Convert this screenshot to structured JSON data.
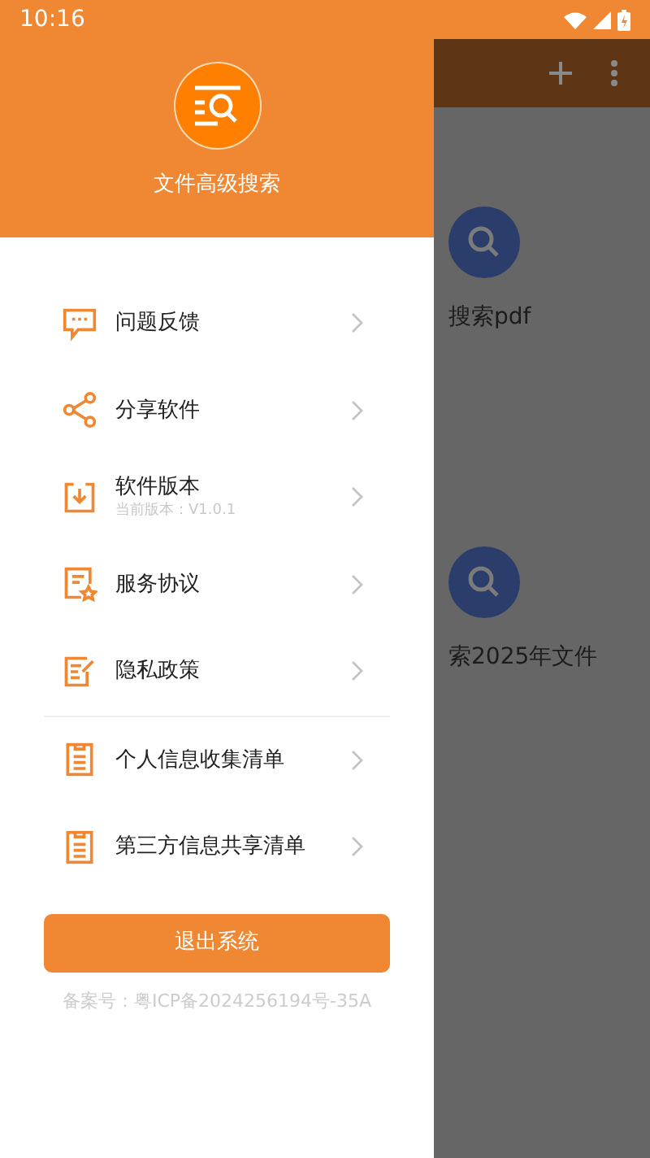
{
  "status_bar": {
    "time": "10:16"
  },
  "drawer": {
    "app_name": "文件高级搜索",
    "menu": [
      {
        "label": "问题反馈"
      },
      {
        "label": "分享软件"
      },
      {
        "label": "软件版本",
        "subtitle": "当前版本：V1.0.1"
      },
      {
        "label": "服务协议"
      },
      {
        "label": "隐私政策"
      },
      {
        "label": "个人信息收集清单"
      },
      {
        "label": "第三方信息共享清单"
      }
    ],
    "logout_button": "退出系统",
    "footer": "备案号：粤ICP备2024256194号-35A"
  },
  "background": {
    "cards": [
      {
        "label": "搜索pdf"
      },
      {
        "label": "索2025年文件"
      }
    ]
  }
}
